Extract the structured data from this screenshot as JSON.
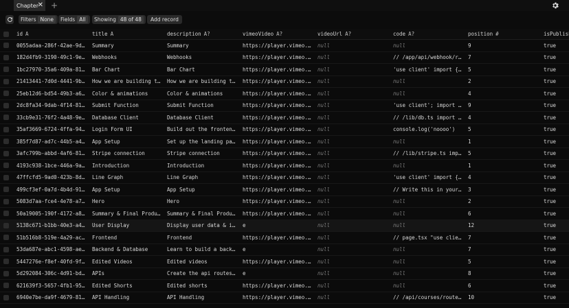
{
  "tabbar": {
    "tab_label": "Chapter",
    "close_glyph": "✕",
    "add_glyph": "+"
  },
  "toolbar": {
    "filters_label": "Filters",
    "filters_value": "None",
    "fields_label": "Fields",
    "fields_value": "All",
    "showing_label": "Showing",
    "showing_value": "48 of 48",
    "add_record_label": "Add record"
  },
  "columns": [
    {
      "key": "id",
      "label": "id",
      "type": "A"
    },
    {
      "key": "title",
      "label": "title",
      "type": "A"
    },
    {
      "key": "description",
      "label": "description",
      "type": "A?"
    },
    {
      "key": "vimeoVideo",
      "label": "vimeoVideo",
      "type": "A?"
    },
    {
      "key": "videoUrl",
      "label": "videoUrl",
      "type": "A?"
    },
    {
      "key": "code",
      "label": "code",
      "type": "A?"
    },
    {
      "key": "position",
      "label": "position",
      "type": "#"
    },
    {
      "key": "isPublished",
      "label": "isPublished",
      "type": ""
    }
  ],
  "rows": [
    {
      "id": "0055adaa-286f-42ae-9d…",
      "title": "Summary",
      "description": "Summary",
      "vimeoVideo": "https://player.vimeo.…",
      "videoUrl": "null",
      "code": "null",
      "position": "9",
      "isPublished": "true"
    },
    {
      "id": "182d4fb9-3190-49c1-9e…",
      "title": "Webhooks",
      "description": "Webhooks",
      "vimeoVideo": "https://player.vimeo.…",
      "videoUrl": "null",
      "code": "// /app/api/webhook/r…",
      "position": "7",
      "isPublished": "true"
    },
    {
      "id": "1bc27970-35a6-409a-81…",
      "title": "Bar Chart",
      "description": "Bar Chart",
      "vimeoVideo": "https://player.vimeo.…",
      "videoUrl": "null",
      "code": "'use client' import {…",
      "position": "5",
      "isPublished": "true"
    },
    {
      "id": "21413441-7d0d-4441-9b…",
      "title": "How we are building t…",
      "description": "How we are building t…",
      "vimeoVideo": "https://player.vimeo.…",
      "videoUrl": "null",
      "code": "null",
      "position": "2",
      "isPublished": "true"
    },
    {
      "id": "25eb12d6-bd54-49b3-a6…",
      "title": "Color & animations",
      "description": "Color & animations",
      "vimeoVideo": "https://player.vimeo.…",
      "videoUrl": "null",
      "code": "null",
      "position": "4",
      "isPublished": "true"
    },
    {
      "id": "2dc8fa34-9dab-4f14-81…",
      "title": "Submit Function",
      "description": "Submit Function",
      "vimeoVideo": "https://player.vimeo.…",
      "videoUrl": "null",
      "code": "'use client'; import …",
      "position": "9",
      "isPublished": "true"
    },
    {
      "id": "33cb9e31-76f2-4a48-9e…",
      "title": "Database Client",
      "description": "Database Client",
      "vimeoVideo": "https://player.vimeo.…",
      "videoUrl": "null",
      "code": "// /lib/db.ts import …",
      "position": "4",
      "isPublished": "true"
    },
    {
      "id": "35af3669-6724-4ffa-94…",
      "title": "Login Form UI",
      "description": "Build out the fronten…",
      "vimeoVideo": "https://player.vimeo.…",
      "videoUrl": "null",
      "code": "console.log('noooo')",
      "position": "5",
      "isPublished": "true"
    },
    {
      "id": "385f7d87-ad7c-44b5-a4…",
      "title": "App Setup",
      "description": "Set up the landing pa…",
      "vimeoVideo": "https://player.vimeo.…",
      "videoUrl": "null",
      "code": "null",
      "position": "1",
      "isPublished": "true"
    },
    {
      "id": "3afc799b-abbd-4af6-81…",
      "title": "Stripe connection",
      "description": "Stripe connection",
      "vimeoVideo": "https://player.vimeo.…",
      "videoUrl": "null",
      "code": "// /lib/stripe.ts imp…",
      "position": "5",
      "isPublished": "true"
    },
    {
      "id": "4193c938-1bce-446a-9a…",
      "title": "Introduction",
      "description": "Introduction",
      "vimeoVideo": "https://player.vimeo.…",
      "videoUrl": "null",
      "code": "null",
      "position": "1",
      "isPublished": "true"
    },
    {
      "id": "47ffcfd5-9ad0-423b-8d…",
      "title": "Line Graph",
      "description": "Line Graph",
      "vimeoVideo": "https://player.vimeo.…",
      "videoUrl": "null",
      "code": "'use client' import {…",
      "position": "4",
      "isPublished": "true"
    },
    {
      "id": "499cf3ef-0a7d-4b4d-91…",
      "title": "App Setup",
      "description": "App Setup",
      "vimeoVideo": "https://player.vimeo.…",
      "videoUrl": "null",
      "code": "// Write this in your…",
      "position": "3",
      "isPublished": "true"
    },
    {
      "id": "5083d7aa-fce4-4e78-a7…",
      "title": "Hero",
      "description": "Hero",
      "vimeoVideo": "https://player.vimeo.…",
      "videoUrl": "null",
      "code": "null",
      "position": "2",
      "isPublished": "true"
    },
    {
      "id": "50a19005-190f-4172-a8…",
      "title": "Summary & Final Produ…",
      "description": "Summary & Final Produ…",
      "vimeoVideo": "https://player.vimeo.…",
      "videoUrl": "null",
      "code": "null",
      "position": "6",
      "isPublished": "true"
    },
    {
      "id": "5138c671-b1bb-40e3-a4…",
      "title": "User Display",
      "description": "Display user data & i…",
      "vimeoVideo": "e",
      "videoUrl": "null",
      "code": "null",
      "position": "12",
      "isPublished": "true"
    },
    {
      "id": "51b516b8-519e-4a29-ac…",
      "title": "Frontend",
      "description": "Frontend",
      "vimeoVideo": "https://player.vimeo.…",
      "videoUrl": "null",
      "code": "// page.tsx \"use clie…",
      "position": "7",
      "isPublished": "true"
    },
    {
      "id": "53da687e-abc1-4598-ae…",
      "title": "Backend & Database",
      "description": "Learn to build a back…",
      "vimeoVideo": "e",
      "videoUrl": "null",
      "code": "null",
      "position": "7",
      "isPublished": "true"
    },
    {
      "id": "5447276e-f8ef-40fd-9f…",
      "title": "Edited Videos",
      "description": "Edited videos",
      "vimeoVideo": "https://player.vimeo.…",
      "videoUrl": "null",
      "code": "null",
      "position": "5",
      "isPublished": "true"
    },
    {
      "id": "5d292084-306c-4d91-bd…",
      "title": "APIs",
      "description": "Create the api routes…",
      "vimeoVideo": "e",
      "videoUrl": "null",
      "code": "null",
      "position": "8",
      "isPublished": "true"
    },
    {
      "id": "621639f3-5657-4fb1-95…",
      "title": "Edited Shorts",
      "description": "Edited shorts",
      "vimeoVideo": "https://player.vimeo.…",
      "videoUrl": "null",
      "code": "null",
      "position": "6",
      "isPublished": "true"
    },
    {
      "id": "6940e7be-da9f-4679-81…",
      "title": "API Handling",
      "description": "API Handling",
      "vimeoVideo": "https://player.vimeo.…",
      "videoUrl": "null",
      "code": "// /api/courses/route…",
      "position": "10",
      "isPublished": "true"
    }
  ]
}
